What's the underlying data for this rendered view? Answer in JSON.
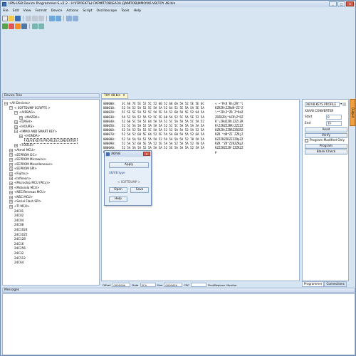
{
  "window": {
    "title": "UPA-USB Device Programmer-S v2.2 - H:\\ПРОЕКТЫ СКРИПТОВ\\БАЗА ДАМПОВ\\ИМО\\X6-V8\\TOY 48.bin"
  },
  "window_buttons": [
    "_",
    "□",
    "✕"
  ],
  "menu": [
    "File",
    "Edit",
    "View",
    "Format",
    "Device",
    "Actions",
    "Script",
    "Oscilloscope",
    "Tools",
    "Help"
  ],
  "device_tree": {
    "title": "Device Tree",
    "items": [
      "<All Devices>",
      "< SOFTDUMP SCRIPTS >",
      "<AIRBAG>",
      "<MAZDA>",
      "<DASH>",
      "<HOURS>",
      "<IMMO AND SMART KEY>",
      "<HONDA>",
      "X6/V8 KEYS PROFILES CONVERTER",
      "<TOOLS>",
      "<Atmel MCU>",
      "<EEPROM I2C>",
      "<EEPROM Microwire>",
      "<EEPROM Miscellaneous>",
      "<EEPROM SPI>",
      "<Fujitsu>",
      "<Infineon>",
      "<Microchip MCU (PICs)>",
      "<Motorola MCU>",
      "<NEC/Renesas MCU>",
      "<NSC MCU>",
      "<Serial Flash SPI>",
      "<TI MCU>",
      "24C01",
      "24C02",
      "24C04",
      "24C08",
      "24C1024",
      "24C1025",
      "24C128",
      "24C16",
      "24C256",
      "24C32",
      "24C512",
      "24C64"
    ]
  },
  "doc_tab": {
    "label": "TOY 48.bin",
    "close": "✕"
  },
  "hex": [
    {
      "addr": "000000:",
      "bytes": "3C A8 7E 5E 52 5C 52 60 52 68 6A 5A 52 5E 5E 6C",
      "ascii": "< ~^R\\R`RhjZR^^l"
    },
    {
      "addr": "000010:",
      "bytes": "52 5A 52 5A 52 5C 5A 5A 52 64 52 5E 5A 5A 5E 5A",
      "ascii": "RZRZR\\ZZRdR^ZZ^Z"
    },
    {
      "addr": "000020:",
      "bytes": "5C 5E 5E 5A 52 5C 5A 5E 5A 52 60 5A 5E 52 64 5A",
      "ascii": "\\^^ZR\\Z^ZR`Z^RdZ"
    },
    {
      "addr": "000030:",
      "bytes": "5A 52 5A 52 5A 52 5C 5E 68 5A 52 5C 5A 5E 52 5A",
      "ascii": "ZRZRZR\\^hZR\\Z^RZ"
    },
    {
      "addr": "000040:",
      "bytes": "52 60 5C 5A 52 64 5A 5A 52 5C 5A 5A 5A 5C 5A 52",
      "ascii": "R`\\ZRdZZR\\ZZZ\\ZR"
    },
    {
      "addr": "000050:",
      "bytes": "52 5C 5A 5A 52 5A 5A 5A 52 52 5C 5A 5A 5A 5A 5A",
      "ascii": "R\\ZZRZZZRR\\ZZZZZ"
    },
    {
      "addr": "000060:",
      "bytes": "52 5A 52 5A 52 5C 5A 5A 52 52 5A 5A 52 5A 52 5A",
      "ascii": "RZRZR\\ZZRRZZRZRZ"
    },
    {
      "addr": "000070:",
      "bytes": "52 5A 52 60 5E 64 52 5E 5A 5A 60 5A 5A 52 6A 5A",
      "ascii": "RZR`^dR^ZZ`ZZRjZ"
    },
    {
      "addr": "000080:",
      "bytes": "52 5A 5A 5A 52 5A 5A 52 5A 5A 5A 5A 52 70 5A 5A",
      "ascii": "RZZZRZZRZZZZRpZZ"
    },
    {
      "addr": "000090:",
      "bytes": "52 5A 52 60 5E 5A 52 5E 5A 5A 52 5A 5A 52 70 5A",
      "ascii": "RZR`^ZR^ZZRZZRpZ"
    },
    {
      "addr": "0000A0:",
      "bytes": "52 5A 5A 5A 52 5A 5A 5A 52 5E 5A 5A 5A 52 5A 5A",
      "ascii": "RZZZRZZZR^ZZZRZZ"
    },
    {
      "addr": "0000B0:",
      "bytes": "70 FA",
      "ascii": "p"
    }
  ],
  "statusbar": {
    "offset_label": "Offset",
    "offset_value": "000000h",
    "data_label": "Data",
    "data_value": "3Ch",
    "size_label": "Size",
    "size_value": "0000A2h",
    "crc_label": "CRC",
    "crc_value": "",
    "find_label": "Find/Replace",
    "monitor_label": "Monitor"
  },
  "right_panel": {
    "profile_select": "X6/V8 KEYS PROFILE",
    "converter_label": "X6/V8 CONVERTER",
    "start_label": "Start",
    "start_value": "0",
    "end_label": "End",
    "end_value": "7F",
    "read_button": "Read",
    "verify_button": "Verify",
    "modified_label": "Program Modified Only",
    "program_button": "Program",
    "blank_check_button": "Blank Check"
  },
  "side_tab": "Output",
  "bottom_tabs": [
    "Programmer",
    "Connections"
  ],
  "messages": {
    "title": "Messages"
  },
  "dialog": {
    "title": "X6/V8",
    "apply_button": "Apply",
    "type_label": "X6/V8 type",
    "brand": "< SOFTDUMP >",
    "open_button": "Open",
    "save_button": "Save",
    "help_button": "Help"
  },
  "colors": {
    "window_bg": "#d7e4f2",
    "border": "#9db3cf",
    "dialog_bg": "#e6eef8",
    "output_tab": "#f0a040",
    "selection_blue": "#3b6fb4"
  }
}
